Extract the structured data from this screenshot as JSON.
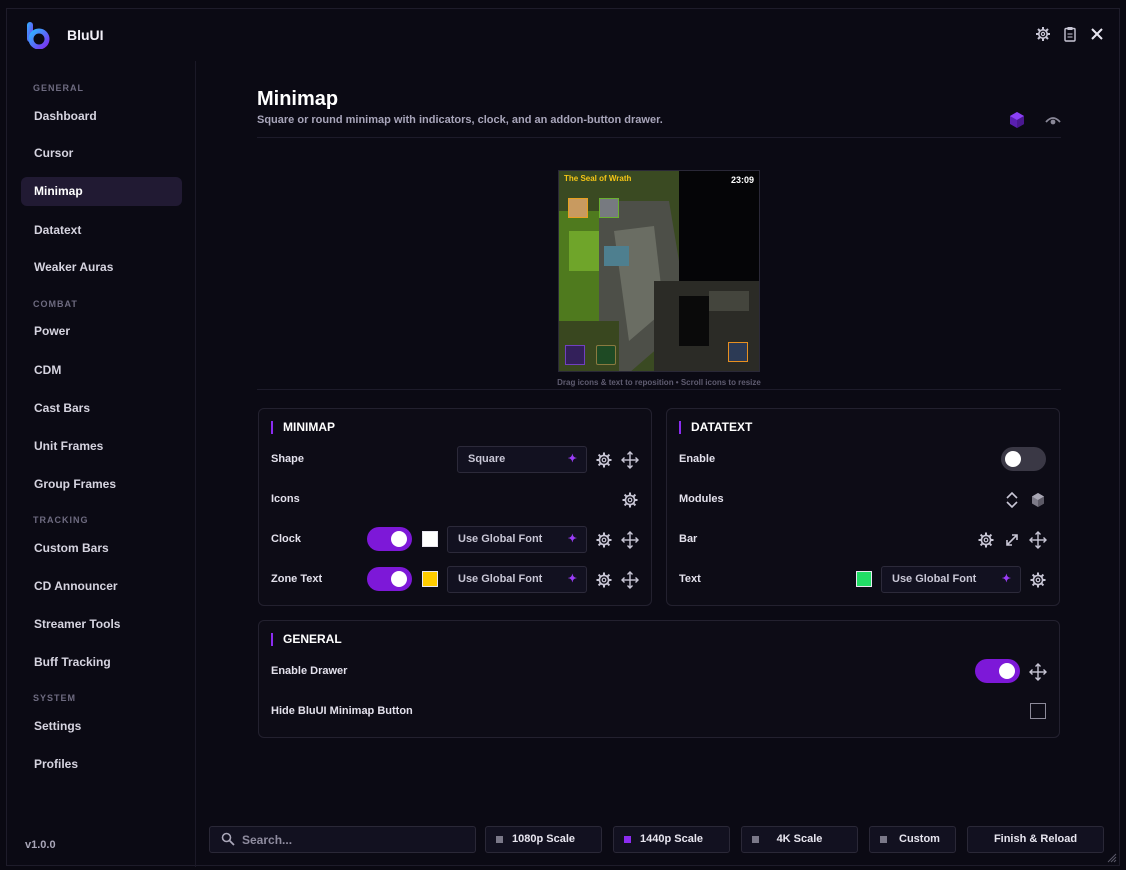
{
  "app": {
    "title": "BluUI",
    "version": "v1.0.0"
  },
  "titlebar_icons": [
    "gear-icon",
    "clipboard-icon",
    "close-icon"
  ],
  "sidebar": {
    "sections": [
      {
        "label": "GENERAL",
        "items": [
          "Dashboard",
          "Cursor",
          "Minimap",
          "Datatext",
          "Weaker Auras"
        ]
      },
      {
        "label": "COMBAT",
        "items": [
          "Power",
          "CDM",
          "Cast Bars",
          "Unit Frames",
          "Group Frames"
        ]
      },
      {
        "label": "TRACKING",
        "items": [
          "Custom Bars",
          "CD Announcer",
          "Streamer Tools",
          "Buff Tracking"
        ]
      },
      {
        "label": "SYSTEM",
        "items": [
          "Settings",
          "Profiles"
        ]
      }
    ],
    "active": "Minimap"
  },
  "page": {
    "title": "Minimap",
    "subtitle": "Square or round minimap with indicators, clock, and an addon-button drawer.",
    "header_icons": [
      "cube-icon",
      "eye-icon"
    ]
  },
  "preview": {
    "zone_text": "The Seal of Wrath",
    "clock": "23:09",
    "hint": "Drag icons & text to reposition  •  Scroll icons to resize"
  },
  "minimap_panel": {
    "title": "MINIMAP",
    "shape_label": "Shape",
    "shape_value": "Square",
    "icons_label": "Icons",
    "clock_label": "Clock",
    "clock_font": "Use Global Font",
    "clock_enabled": true,
    "clock_color": "#ffffff",
    "zone_label": "Zone Text",
    "zone_font": "Use Global Font",
    "zone_enabled": true,
    "zone_color": "#ffcc00"
  },
  "datatext_panel": {
    "title": "DATATEXT",
    "enable_label": "Enable",
    "enabled": false,
    "modules_label": "Modules",
    "bar_label": "Bar",
    "text_label": "Text",
    "text_font": "Use Global Font",
    "text_color": "#22dd66"
  },
  "general_panel": {
    "title": "GENERAL",
    "drawer_label": "Enable Drawer",
    "drawer_enabled": true,
    "hide_label": "Hide BluUI Minimap Button",
    "hide_checked": false
  },
  "footer": {
    "search_placeholder": "Search...",
    "scales": [
      {
        "label": "1080p Scale",
        "selected": false
      },
      {
        "label": "1440p Scale",
        "selected": true
      },
      {
        "label": "4K Scale",
        "selected": false
      },
      {
        "label": "Custom",
        "selected": false
      }
    ],
    "finish_label": "Finish & Reload"
  },
  "colors": {
    "accent": "#8b2cf0",
    "toggle_on": "#7d18d8",
    "background": "#0b0a14"
  }
}
